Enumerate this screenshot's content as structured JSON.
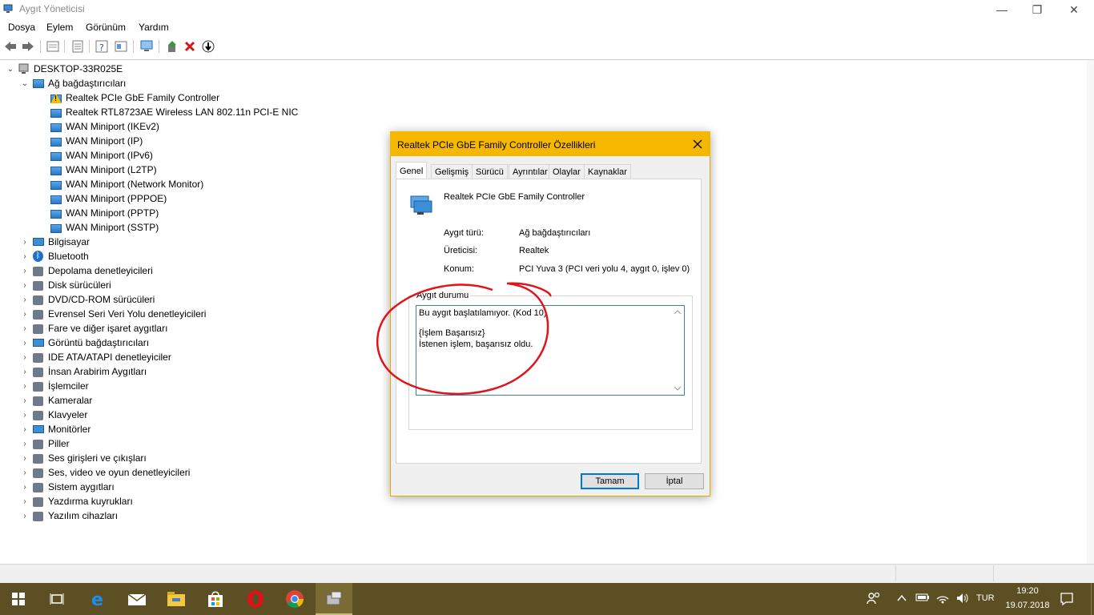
{
  "window": {
    "title": "Aygıt Yöneticisi",
    "minimize": "—",
    "maximize": "❐",
    "close": "✕"
  },
  "menu": [
    "Dosya",
    "Eylem",
    "Görünüm",
    "Yardım"
  ],
  "tree": {
    "root": "DESKTOP-33R025E",
    "expanded_category": "Ağ bağdaştırıcıları",
    "network_items": [
      "Realtek PCIe GbE Family Controller",
      "Realtek RTL8723AE Wireless LAN 802.11n PCI-E NIC",
      "WAN Miniport (IKEv2)",
      "WAN Miniport (IP)",
      "WAN Miniport (IPv6)",
      "WAN Miniport (L2TP)",
      "WAN Miniport (Network Monitor)",
      "WAN Miniport (PPPOE)",
      "WAN Miniport (PPTP)",
      "WAN Miniport (SSTP)"
    ],
    "categories": [
      "Bilgisayar",
      "Bluetooth",
      "Depolama denetleyicileri",
      "Disk sürücüleri",
      "DVD/CD-ROM sürücüleri",
      "Evrensel Seri Veri Yolu denetleyicileri",
      "Fare ve diğer işaret aygıtları",
      "Görüntü bağdaştırıcıları",
      "IDE ATA/ATAPI denetleyiciler",
      "İnsan Arabirim Aygıtları",
      "İşlemciler",
      "Kameralar",
      "Klavyeler",
      "Monitörler",
      "Piller",
      "Ses girişleri ve çıkışları",
      "Ses, video ve oyun denetleyicileri",
      "Sistem aygıtları",
      "Yazdırma kuyrukları",
      "Yazılım cihazları"
    ]
  },
  "dialog": {
    "title": "Realtek PCIe GbE Family Controller Özellikleri",
    "tabs": [
      "Genel",
      "Gelişmiş",
      "Sürücü",
      "Ayrıntılar",
      "Olaylar",
      "Kaynaklar"
    ],
    "device_name": "Realtek PCIe GbE Family Controller",
    "fields": {
      "type_label": "Aygıt türü:",
      "type_value": "Ağ bağdaştırıcıları",
      "maker_label": "Üreticisi:",
      "maker_value": "Realtek",
      "location_label": "Konum:",
      "location_value": "PCI Yuva 3 (PCI veri yolu 4, aygıt 0, işlev 0)"
    },
    "status_group_label": "Aygıt durumu",
    "status_lines": [
      "Bu aygıt başlatılamıyor. (Kod 10)",
      "{İşlem Başarısız}",
      "İstenen işlem, başarısız oldu."
    ],
    "ok": "Tamam",
    "cancel": "İptal"
  },
  "taskbar": {
    "lang": "TUR",
    "time": "19:20",
    "date": "19.07.2018"
  },
  "colors": {
    "dialog_title": "#f6b700",
    "taskbar": "#5c4f23",
    "annotation": "#e0151c"
  }
}
